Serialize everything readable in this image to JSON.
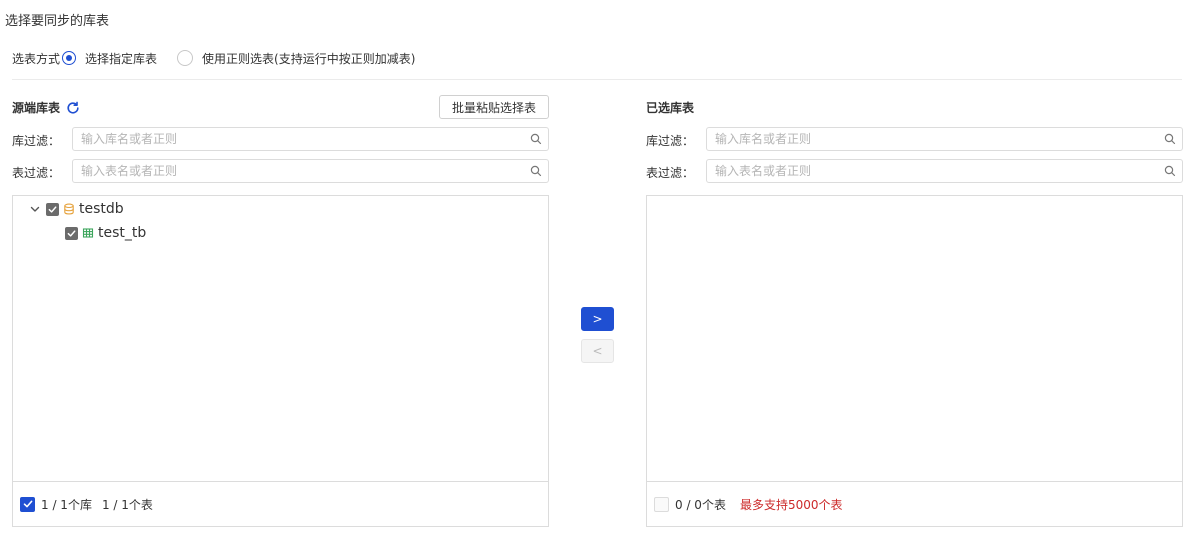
{
  "title": "选择要同步的库表",
  "mode": {
    "label": "选表方式",
    "options": [
      {
        "label": "选择指定库表",
        "checked": true
      },
      {
        "label": "使用正则选表(支持运行中按正则加减表)",
        "checked": false
      }
    ]
  },
  "source": {
    "title": "源端库表",
    "batch_paste_label": "批量粘贴选择表",
    "db_filter_label": "库过滤：",
    "db_filter_placeholder": "输入库名或者正则",
    "table_filter_label": "表过滤：",
    "table_filter_placeholder": "输入表名或者正则",
    "tree": [
      {
        "name": "testdb",
        "type": "database",
        "checked": true,
        "expanded": true,
        "children": [
          {
            "name": "test_tb",
            "type": "table",
            "checked": true
          }
        ]
      }
    ],
    "footer_db_count": "1 / 1个库",
    "footer_table_count": "1 / 1个表"
  },
  "transfer": {
    "add_label": ">",
    "remove_label": "<"
  },
  "target": {
    "title": "已选库表",
    "db_filter_label": "库过滤：",
    "db_filter_placeholder": "输入库名或者正则",
    "table_filter_label": "表过滤：",
    "table_filter_placeholder": "输入表名或者正则",
    "footer_table_count": "0 / 0个表",
    "limit_text": "最多支持5000个表"
  },
  "colors": {
    "accent": "#1f4fd2",
    "warning": "#cc2a2a",
    "database_icon": "#e6a23c",
    "table_icon": "#3ca55c"
  }
}
